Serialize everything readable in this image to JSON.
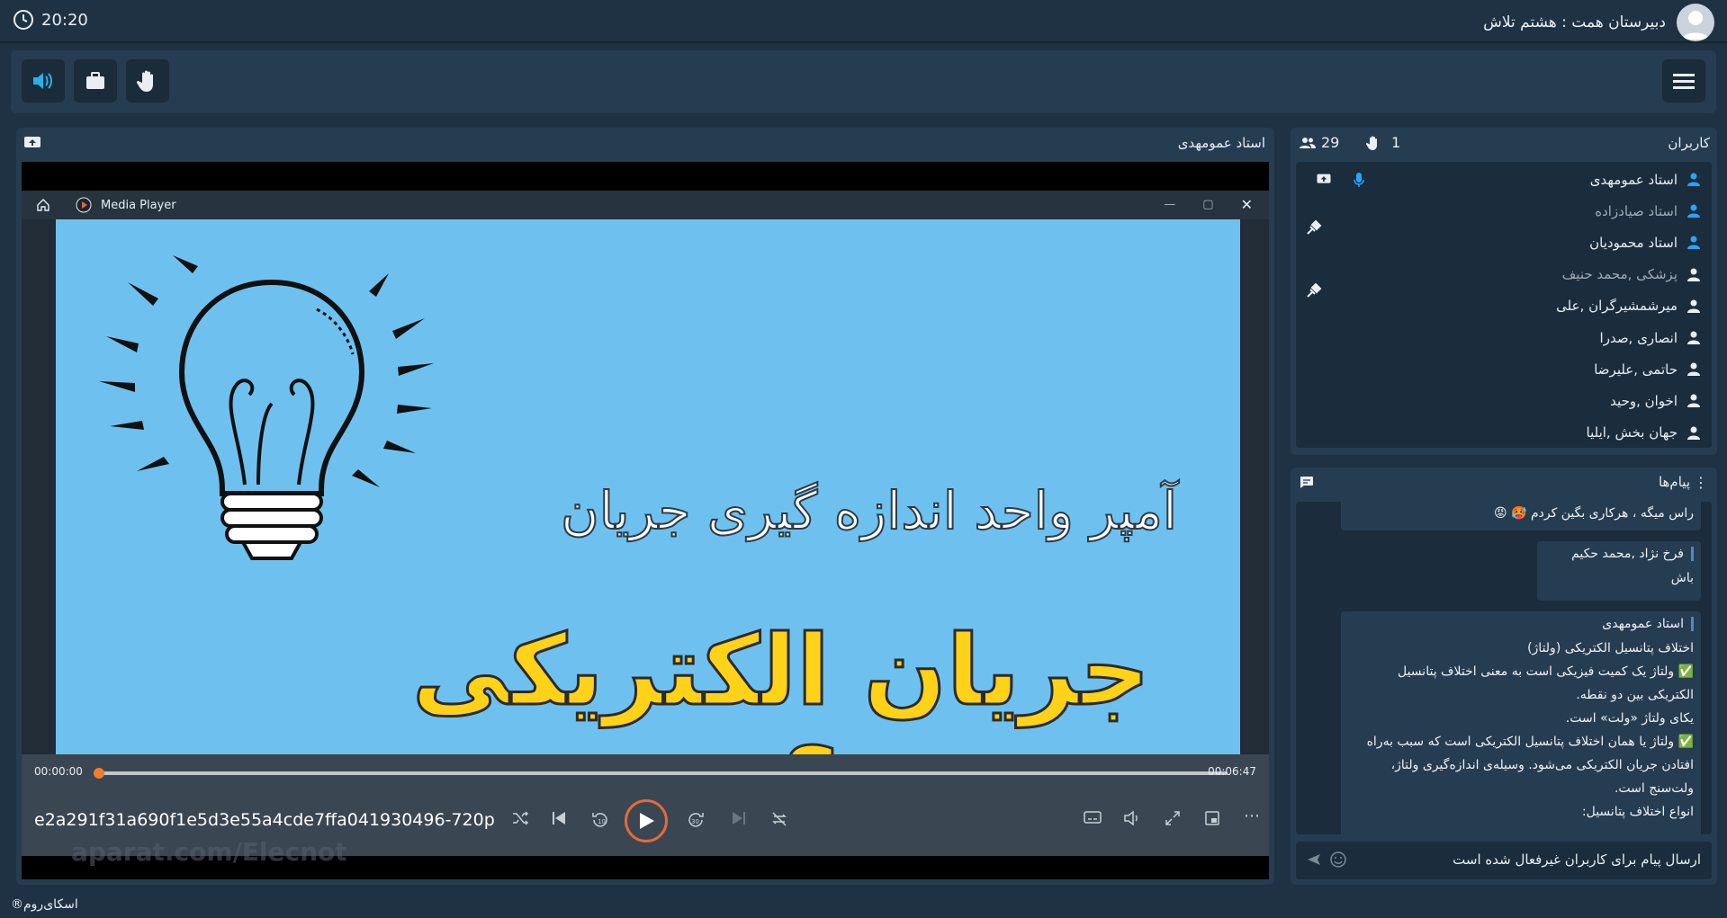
{
  "header": {
    "time": "20:20",
    "room_title": "دبیرستان همت : هشتم تلاش"
  },
  "video": {
    "presenter_label": "استاد عمومهدی",
    "player": {
      "app_name": "Media Player",
      "slide_subtitle": "آمپر واحد اندازه گیری جریان",
      "slide_title": "جریان الکتریکی چیست؟",
      "current_time": "00:00:00",
      "total_time": "00:06:47",
      "progress": 0.0,
      "filename": "e2a291f31a690f1e5d3e55a4cde7ffa041930496-720p",
      "watermark": "aparat.com/Elecnot"
    }
  },
  "users": {
    "title": "کاربران",
    "raised_hands": "1",
    "count": "29",
    "items": [
      {
        "name": "استاد عمومهدی",
        "icon": "user-icon",
        "role": "teacher",
        "extras": [
          "mic-icon",
          "share-screen-icon"
        ]
      },
      {
        "name": "استاد صیادزاده",
        "icon": "user-icon",
        "role": "teacher-dim",
        "extras": [
          "plug-icon"
        ]
      },
      {
        "name": "استاد محمودیان",
        "icon": "user-icon",
        "role": "teacher",
        "extras": []
      },
      {
        "name": "پزشکی ,محمد حنیف",
        "icon": "user-icon",
        "role": "student-dim",
        "extras": [
          "plug-icon"
        ]
      },
      {
        "name": "میرشمشیرگران ,علی",
        "icon": "user-icon",
        "role": "student",
        "extras": []
      },
      {
        "name": "انصاری ,صدرا",
        "icon": "user-icon",
        "role": "student",
        "extras": []
      },
      {
        "name": "حاتمی ,علیرضا",
        "icon": "user-icon",
        "role": "student",
        "extras": []
      },
      {
        "name": "اخوان ,وحید",
        "icon": "user-icon",
        "role": "student",
        "extras": []
      },
      {
        "name": "جهان بخش ,ایلیا",
        "icon": "user-icon",
        "role": "student",
        "extras": []
      }
    ]
  },
  "messages": {
    "title": "پیام‌ها",
    "items": [
      {
        "lines": [
          "راس میگه ، هرکاری بگین کردم 🥵 😡"
        ]
      },
      {
        "author": "فرخ نژاد ,محمد حکیم",
        "lines": [
          "باش"
        ]
      },
      {
        "author": "استاد عمومهدی",
        "lines": [
          "اختلاف پتانسیل الکتریکی (ولتاژ)",
          "✅ ولتاژ یک کمیت فیزیکی است به معنی اختلاف پتانسیل",
          "الکتریکی بین دو نقطه.",
          "یکای ولتاژ «ولت» است.",
          "✅ ولتاژ یا همان اختلاف پتانسیل الکتریکی است که سبب به‌راه",
          "افتادن جریان الکتریکی می‌شود. وسیله‌ی اندازه‌گیری ولتاژ،",
          "ولت‌سنج است.",
          "انواع اختلاف پتانسیل:"
        ]
      }
    ],
    "input_placeholder": "ارسال پیام برای کاربران غیرفعال شده است"
  },
  "footer": {
    "brand": "اسکای‌روم®"
  },
  "colors": {
    "accent_blue": "#2aa3ff",
    "speaker_active": "#2ab0e6",
    "slide_bg": "#6ec1ef",
    "slide_title": "#ffd21a",
    "seek_dot": "#f07d2e"
  }
}
